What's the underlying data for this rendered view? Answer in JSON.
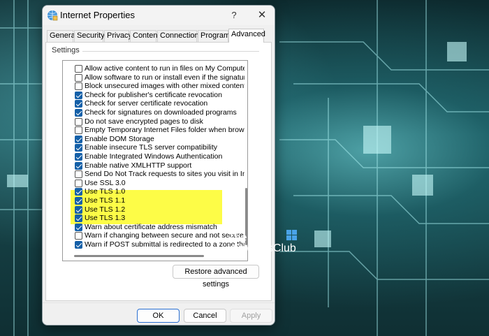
{
  "window": {
    "title": "Internet Properties",
    "help_glyph": "?",
    "close_glyph": "✕"
  },
  "tabs": [
    {
      "label": "General"
    },
    {
      "label": "Security"
    },
    {
      "label": "Privacy"
    },
    {
      "label": "Content"
    },
    {
      "label": "Connections"
    },
    {
      "label": "Programs"
    },
    {
      "label": "Advanced",
      "active": true
    }
  ],
  "settings": {
    "group_label": "Settings",
    "items": [
      {
        "label": "Allow active content to run in files on My Computer",
        "checked": false
      },
      {
        "label": "Allow software to run or install even if the signature is inv",
        "checked": false
      },
      {
        "label": "Block unsecured images with other mixed content",
        "checked": false
      },
      {
        "label": "Check for publisher's certificate revocation",
        "checked": true
      },
      {
        "label": "Check for server certificate revocation",
        "checked": true
      },
      {
        "label": "Check for signatures on downloaded programs",
        "checked": true
      },
      {
        "label": "Do not save encrypted pages to disk",
        "checked": false
      },
      {
        "label": "Empty Temporary Internet Files folder when browser is cl",
        "checked": false
      },
      {
        "label": "Enable DOM Storage",
        "checked": true
      },
      {
        "label": "Enable insecure TLS server compatibility",
        "checked": true
      },
      {
        "label": "Enable Integrated Windows Authentication",
        "checked": true
      },
      {
        "label": "Enable native XMLHTTP support",
        "checked": true
      },
      {
        "label": "Send Do Not Track requests to sites you visit in Internet E",
        "checked": false
      },
      {
        "label": "Use SSL 3.0",
        "checked": false
      },
      {
        "label": "Use TLS 1.0",
        "checked": true,
        "highlighted": true
      },
      {
        "label": "Use TLS 1.1",
        "checked": true,
        "highlighted": true
      },
      {
        "label": "Use TLS 1.2",
        "checked": true,
        "highlighted": true
      },
      {
        "label": "Use TLS 1.3",
        "checked": true,
        "highlighted": true
      },
      {
        "label": "Warn about certificate address mismatch",
        "checked": true
      },
      {
        "label": "Warn if changing between secure and not secure mode",
        "checked": false
      },
      {
        "label": "Warn if POST submittal is redirected to a zone that does",
        "checked": true
      }
    ]
  },
  "buttons": {
    "restore": "Restore advanced settings",
    "ok": "OK",
    "cancel": "Cancel",
    "apply": "Apply"
  },
  "watermark": {
    "line1": "The",
    "line2": "WindowsClub"
  },
  "colors": {
    "highlight": "#fdfc47",
    "checkbox_checked": "#1560a8",
    "ok_border": "#2a6fd1"
  }
}
